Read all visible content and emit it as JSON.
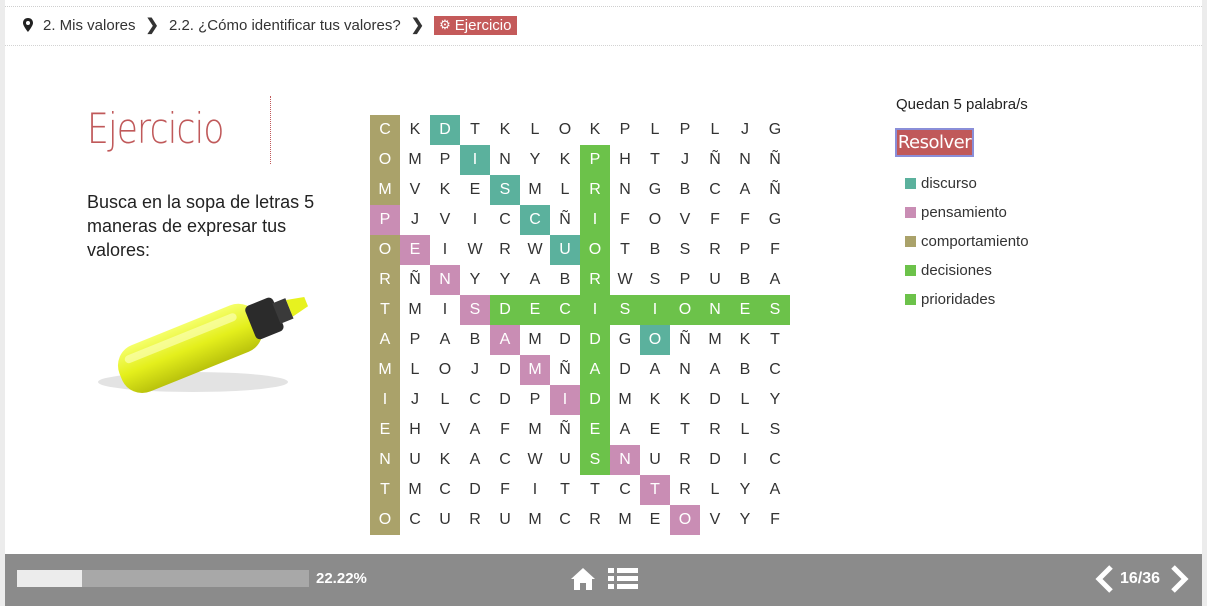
{
  "breadcrumb": {
    "item1": "2. Mis valores",
    "item2": "2.2. ¿Cómo identificar tus valores?",
    "current": "Ejercicio"
  },
  "main": {
    "title": "Ejercicio",
    "instructions": "Busca en la sopa de letras 5 maneras de expresar tus valores:"
  },
  "wordsearch": {
    "rows": [
      "CKDTKLOKPLPLJG",
      "OMPINYKPHTJÑNÑ",
      "MVKESMLRNGBCAÑ",
      "PJVICCÑIFOVFFG",
      "OEIWRWUOTBSRPF",
      "RÑNYYABRWSPUBA",
      "TMISDECISIONES",
      "APABAMDDGOÑMKT",
      "MLOJDMÑADANABC",
      "IJLCDPIDMKKDLY",
      "EHVAFMÑEAETRLS",
      "NUKACWUSNURDIC",
      "TMCDFITTCTRLYA",
      "OCURUMCRMEOVYF"
    ],
    "highlights": [
      {
        "word": "comportamiento",
        "color": "#aaa26a",
        "cells": [
          [
            0,
            0
          ],
          [
            1,
            0
          ],
          [
            2,
            0
          ],
          [
            3,
            0
          ],
          [
            4,
            0
          ],
          [
            5,
            0
          ],
          [
            6,
            0
          ],
          [
            7,
            0
          ],
          [
            8,
            0
          ],
          [
            9,
            0
          ],
          [
            10,
            0
          ],
          [
            11,
            0
          ],
          [
            12,
            0
          ],
          [
            13,
            0
          ]
        ]
      },
      {
        "word": "discurso",
        "color": "#5bb19d",
        "cells": [
          [
            0,
            2
          ],
          [
            1,
            3
          ],
          [
            2,
            4
          ],
          [
            3,
            5
          ],
          [
            4,
            6
          ],
          [
            5,
            7
          ],
          [
            6,
            8
          ],
          [
            7,
            9
          ]
        ]
      },
      {
        "word": "pensamiento",
        "color": "#c98db4",
        "cells": [
          [
            3,
            0
          ],
          [
            4,
            1
          ],
          [
            5,
            2
          ],
          [
            6,
            3
          ],
          [
            7,
            4
          ],
          [
            8,
            5
          ],
          [
            9,
            6
          ],
          [
            10,
            7
          ],
          [
            11,
            8
          ],
          [
            12,
            9
          ],
          [
            13,
            10
          ]
        ]
      },
      {
        "word": "prioridades",
        "color": "#6cc24a",
        "cells": [
          [
            1,
            7
          ],
          [
            2,
            7
          ],
          [
            3,
            7
          ],
          [
            4,
            7
          ],
          [
            5,
            7
          ],
          [
            6,
            7
          ],
          [
            7,
            7
          ],
          [
            8,
            7
          ],
          [
            9,
            7
          ],
          [
            10,
            7
          ],
          [
            11,
            7
          ]
        ]
      },
      {
        "word": "decisiones",
        "color": "#6cc24a",
        "cells": [
          [
            6,
            4
          ],
          [
            6,
            5
          ],
          [
            6,
            6
          ],
          [
            6,
            7
          ],
          [
            6,
            8
          ],
          [
            6,
            9
          ],
          [
            6,
            10
          ],
          [
            6,
            11
          ],
          [
            6,
            12
          ],
          [
            6,
            13
          ]
        ]
      }
    ]
  },
  "sidebar": {
    "remaining": "Quedan 5 palabra/s",
    "resolver_label": "Resolver",
    "words": [
      {
        "label": "discurso",
        "color": "#5bb19d"
      },
      {
        "label": "pensamiento",
        "color": "#c98db4"
      },
      {
        "label": "comportamiento",
        "color": "#aaa26a"
      },
      {
        "label": "decisiones",
        "color": "#6cc24a"
      },
      {
        "label": "prioridades",
        "color": "#6cc24a"
      }
    ]
  },
  "footer": {
    "progress": 0.2222,
    "progress_label": "22.22%",
    "page": "16/36",
    "icons": [
      "home-icon",
      "list-icon",
      "chevron-left-icon",
      "chevron-right-icon"
    ]
  }
}
